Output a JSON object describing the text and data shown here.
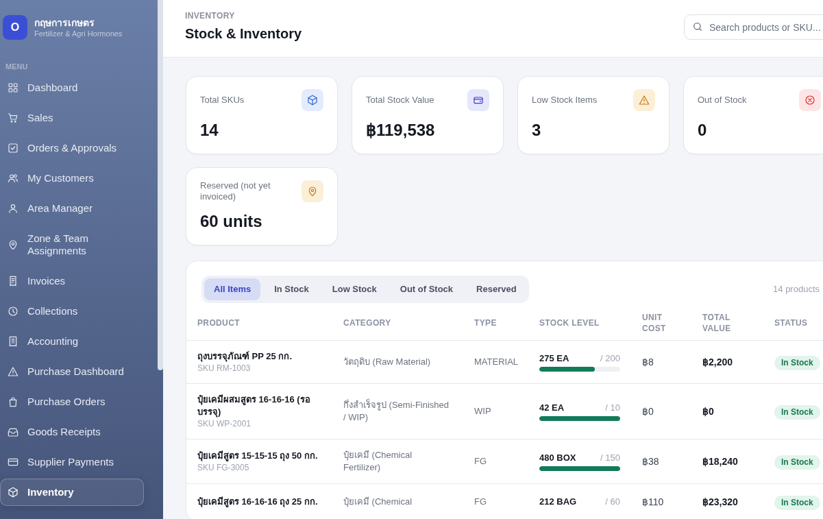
{
  "sidebar": {
    "brand": {
      "logo": "O",
      "name": "กฤษการเกษตร",
      "tagline": "Fertilizer & Agri Hormones"
    },
    "section_label": "MENU",
    "items": [
      {
        "label": "Dashboard",
        "kind": "dashboard",
        "selected": false
      },
      {
        "label": "Sales",
        "kind": "sales",
        "selected": false
      },
      {
        "label": "Orders & Approvals",
        "kind": "orders",
        "selected": false
      },
      {
        "label": "My Customers",
        "kind": "customers",
        "selected": false
      },
      {
        "label": "Area Manager",
        "kind": "manager",
        "selected": false
      },
      {
        "label": "Zone & Team Assignments",
        "kind": "zones",
        "selected": false
      },
      {
        "label": "Invoices",
        "kind": "invoices",
        "selected": false
      },
      {
        "label": "Collections",
        "kind": "collections",
        "selected": false
      },
      {
        "label": "Accounting",
        "kind": "accounting",
        "selected": false
      },
      {
        "label": "Purchase Dashboard",
        "kind": "purchase",
        "selected": false
      },
      {
        "label": "Purchase Orders",
        "kind": "po",
        "selected": false
      },
      {
        "label": "Goods Receipts",
        "kind": "receipts",
        "selected": false
      },
      {
        "label": "Supplier Payments",
        "kind": "payments",
        "selected": false
      },
      {
        "label": "Inventory",
        "kind": "inventory",
        "selected": true
      }
    ]
  },
  "header": {
    "eyebrow": "INVENTORY",
    "title": "Stock & Inventory",
    "search": {
      "placeholder": "Search products or SKU..."
    }
  },
  "stats": [
    {
      "label": "Total SKUs",
      "value": "14",
      "kind": "skus"
    },
    {
      "label": "Total Stock Value",
      "value": "฿119,538",
      "kind": "value"
    },
    {
      "label": "Low Stock Items",
      "value": "3",
      "kind": "low"
    },
    {
      "label": "Out of Stock",
      "value": "0",
      "kind": "out"
    },
    {
      "label": "Reserved (not yet invoiced)",
      "value": "60 units",
      "kind": "reserved"
    }
  ],
  "inventory_table": {
    "tabs": [
      {
        "label": "All Items",
        "selected": true
      },
      {
        "label": "In Stock",
        "selected": false
      },
      {
        "label": "Low Stock",
        "selected": false
      },
      {
        "label": "Out of Stock",
        "selected": false
      },
      {
        "label": "Reserved",
        "selected": false
      }
    ],
    "count": "14 products",
    "columns": [
      "PRODUCT",
      "CATEGORY",
      "TYPE",
      "STOCK LEVEL",
      "UNIT COST",
      "TOTAL VALUE",
      "STATUS"
    ],
    "rows": [
      {
        "product": "ถุงบรรจุภัณฑ์ PP 25 กก.",
        "sku": "SKU RM-1003",
        "category": "วัตถุดิบ (Raw Material)",
        "type": "MATERIAL",
        "stock": {
          "quantity": "275 EA",
          "target": "/ 200",
          "level": 0.69
        },
        "unit_cost": "฿8",
        "total_value": "฿2,200",
        "status": {
          "label": "In Stock",
          "kind": "in_stock"
        }
      },
      {
        "product": "ปุ๋ยเคมีผสมสูตร 16-16-16 (รอบรรจุ)",
        "sku": "SKU WP-2001",
        "category": "กึ่งสำเร็จรูป (Semi-Finished / WIP)",
        "type": "WIP",
        "stock": {
          "quantity": "42 EA",
          "target": "/ 10",
          "level": 1
        },
        "unit_cost": "฿0",
        "total_value": "฿0",
        "status": {
          "label": "In Stock",
          "kind": "in_stock"
        }
      },
      {
        "product": "ปุ๋ยเคมีสูตร 15-15-15 ถุง 50 กก.",
        "sku": "SKU FG-3005",
        "category": "ปุ๋ยเคมี (Chemical Fertilizer)",
        "type": "FG",
        "stock": {
          "quantity": "480 BOX",
          "target": "/ 150",
          "level": 1
        },
        "unit_cost": "฿38",
        "total_value": "฿18,240",
        "status": {
          "label": "In Stock",
          "kind": "in_stock"
        }
      },
      {
        "product": "ปุ๋ยเคมีสูตร 16-16-16 ถุง 25 กก.",
        "category": "ปุ๋ยเคมี (Chemical",
        "type": "FG",
        "stock": {
          "quantity": "212 BAG",
          "target": "/ 60"
        },
        "unit_cost": "฿110",
        "total_value": "฿23,320",
        "status": {
          "label": "In Stock",
          "kind": "in_stock"
        }
      }
    ]
  }
}
